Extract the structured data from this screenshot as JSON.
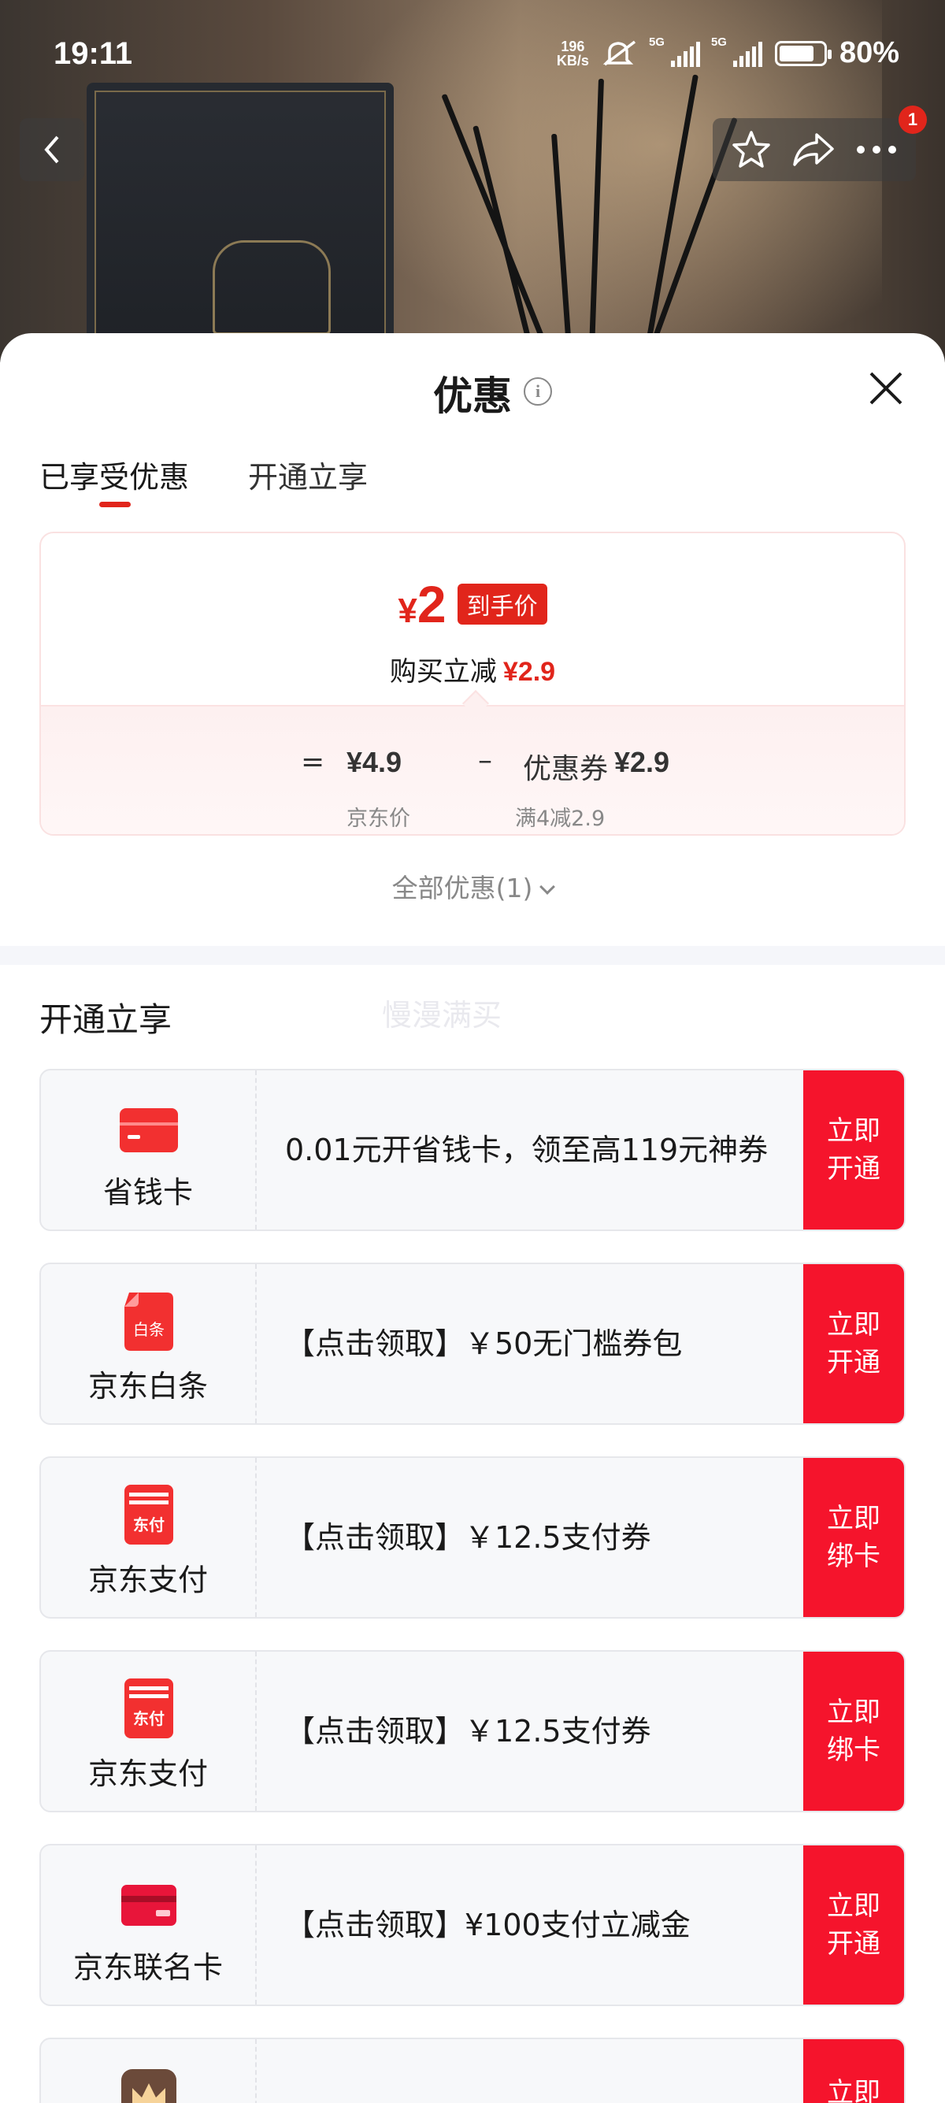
{
  "status_bar": {
    "time": "19:11",
    "net_speed_top": "196",
    "net_speed_bottom": "KB/s",
    "signal_1": "5G",
    "signal_2": "5G",
    "battery": "80%"
  },
  "header": {
    "title": "优惠",
    "cart_badge": "1"
  },
  "tabs": [
    {
      "label": "已享受优惠",
      "active": true
    },
    {
      "label": "开通立享",
      "active": false
    }
  ],
  "price_card": {
    "currency": "¥",
    "final_price": "2",
    "final_tag": "到手价",
    "discount_label": "购买立减",
    "discount_amount": "¥2.9",
    "equals": "=",
    "base_price": "¥4.9",
    "minus": "–",
    "coupon_label": "优惠券",
    "coupon_amount": "¥2.9",
    "base_price_caption": "京东价",
    "coupon_caption": "满4减2.9"
  },
  "all_discounts": "全部优惠(1)",
  "section": {
    "title": "开通立享",
    "watermark": "慢漫满买"
  },
  "offers": [
    {
      "brand": "省钱卡",
      "icon": "card-icon",
      "desc": "0.01元开省钱卡，领至高119元神券",
      "cta": "立即开通"
    },
    {
      "brand": "京东白条",
      "icon": "baitiao-icon",
      "icon_text": "白条",
      "desc": "【点击领取】￥50无门槛券包",
      "cta": "立即开通"
    },
    {
      "brand": "京东支付",
      "icon": "jd-pay-icon",
      "icon_text": "东付",
      "desc": "【点击领取】￥12.5支付券",
      "cta": "立即绑卡"
    },
    {
      "brand": "京东支付",
      "icon": "jd-pay-icon",
      "icon_text": "东付",
      "desc": "【点击领取】￥12.5支付券",
      "cta": "立即绑卡"
    },
    {
      "brand": "京东联名卡",
      "icon": "co-brand-card-icon",
      "desc": "【点击领取】¥100支付立减金",
      "cta": "立即开通"
    },
    {
      "brand": "",
      "icon": "crown-icon",
      "desc": "",
      "cta": "立即"
    }
  ],
  "colors": {
    "accent_red": "#e1251b",
    "cta_red": "#f5142c"
  }
}
